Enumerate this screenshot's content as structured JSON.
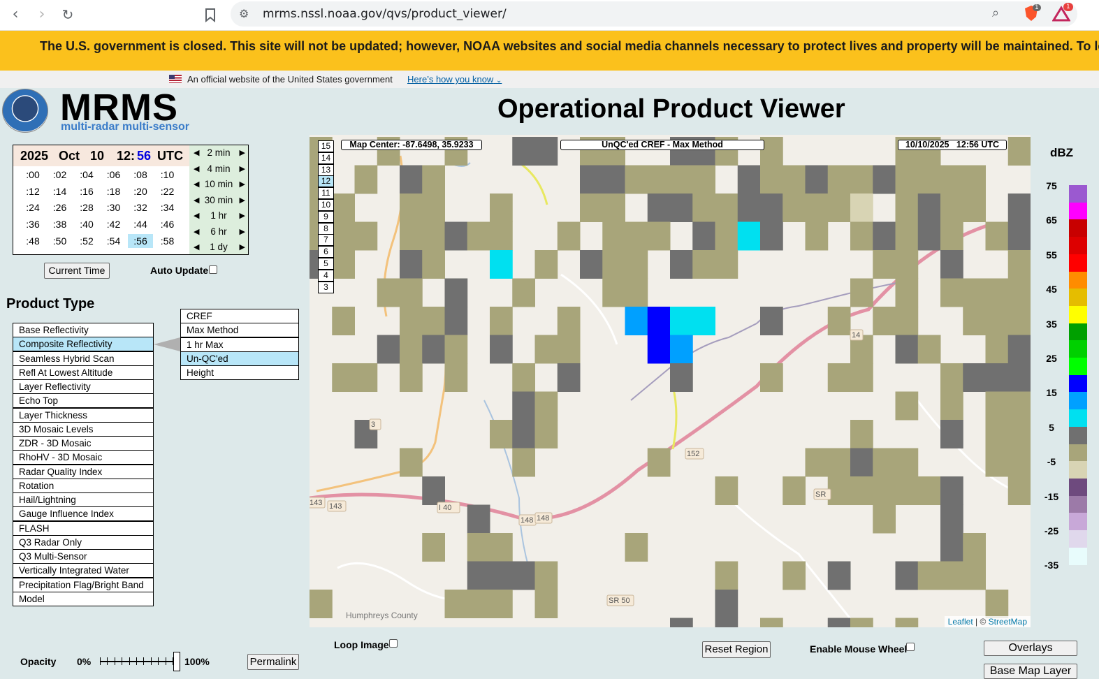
{
  "browser": {
    "url": "mrms.nssl.noaa.gov/qvs/product_viewer/",
    "ext_badge_1": "1",
    "ext_badge_2": "1"
  },
  "banner": {
    "text": "The U.S. government is closed. This site will not be updated; however, NOAA websites and social media channels necessary to protect lives and property will be maintained. To le"
  },
  "official": {
    "text": "An official website of the United States government",
    "link": "Here’s how you know"
  },
  "header": {
    "logo_text": "MRMS",
    "logo_sub": "multi-radar multi-sensor",
    "title": "Operational Product Viewer"
  },
  "time": {
    "year": "2025",
    "month": "Oct",
    "day": "10",
    "hour": "12:",
    "minute": "56",
    "zone": "UTC",
    "minutes": [
      ":00",
      ":02",
      ":04",
      ":06",
      ":08",
      ":10",
      ":12",
      ":14",
      ":16",
      ":18",
      ":20",
      ":22",
      ":24",
      ":26",
      ":28",
      ":30",
      ":32",
      ":34",
      ":36",
      ":38",
      ":40",
      ":42",
      ":44",
      ":46",
      ":48",
      ":50",
      ":52",
      ":54",
      ":56",
      ":58"
    ],
    "selected_minute": ":56",
    "steps": [
      "2 min",
      "4 min",
      "10 min",
      "30 min",
      "1 hr",
      "6 hr",
      "1 dy"
    ]
  },
  "controls": {
    "current_time": "Current Time",
    "auto_update": "Auto Update",
    "loop_image": "Loop Image",
    "reset_region": "Reset Region",
    "enable_mouse_wheel": "Enable Mouse Wheel",
    "overlays": "Overlays",
    "base_map_layer": "Base Map Layer",
    "opacity": "Opacity",
    "opacity_min": "0%",
    "opacity_max": "100%",
    "opacity_value": 1.0,
    "permalink": "Permalink"
  },
  "product_type": {
    "title": "Product Type",
    "items": [
      "Base Reflectivity",
      "Composite Reflectivity",
      "Seamless Hybrid Scan",
      "Refl At Lowest Altitude",
      "Layer Reflectivity",
      "Echo Top",
      "Layer Thickness",
      "3D Mosaic Levels",
      "ZDR - 3D Mosaic",
      "RhoHV - 3D Mosaic",
      "Radar Quality Index",
      "Rotation",
      "Hail/Lightning",
      "Gauge Influence Index",
      "FLASH",
      "Q3 Radar Only",
      "Q3 Multi-Sensor",
      "Vertically Integrated Water",
      "Precipitation Flag/Bright Band",
      "Model"
    ],
    "selected": "Composite Reflectivity",
    "subitems": [
      "CREF",
      "Max Method",
      "1 hr Max",
      "Un-QC'ed",
      "Height"
    ],
    "selected_sub": "Un-QC'ed"
  },
  "map": {
    "center": "Map Center: -87.6498, 35.9233",
    "product": "UnQC'ed CREF - Max Method",
    "datetime": "10/10/2025   12:56 UTC",
    "zoom_levels": [
      "15",
      "14",
      "13",
      "12",
      "11",
      "10",
      "9",
      "8",
      "7",
      "6",
      "5",
      "4",
      "3"
    ],
    "selected_zoom": "12",
    "attribution_leaflet": "Leaflet",
    "attribution_rest": " | © ",
    "attribution_osm": "StreetMap",
    "road_labels": [
      "I 40",
      "SR 50",
      "SR",
      "152",
      "143",
      "143",
      "148",
      "148",
      "14",
      "3"
    ],
    "place_labels": [
      "Humphreys County"
    ]
  },
  "scale": {
    "unit": "dBZ",
    "ticks": [
      "75",
      "65",
      "55",
      "45",
      "35",
      "25",
      "15",
      "5",
      "-5",
      "-15",
      "-25",
      "-35"
    ],
    "colors": [
      "#9b59d0",
      "#ff00ff",
      "#c80000",
      "#dd0000",
      "#ff0000",
      "#ff8c00",
      "#e5bd00",
      "#ffff00",
      "#00a000",
      "#00d000",
      "#00ff00",
      "#0000ff",
      "#00a0ff",
      "#00e0f0",
      "#707070",
      "#a8a57a",
      "#d8d4b4",
      "#6e4a7e",
      "#9c7aa8",
      "#c8a8d8",
      "#e0d8ec",
      "#e8fcfc"
    ]
  }
}
